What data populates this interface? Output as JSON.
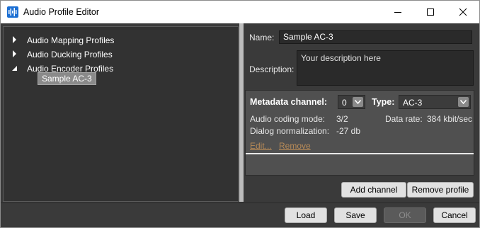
{
  "window": {
    "title": "Audio Profile Editor",
    "icon": "audio-waveform-icon"
  },
  "tree": {
    "items": [
      {
        "label": "Audio Mapping Profiles",
        "expanded": false
      },
      {
        "label": "Audio Ducking Profiles",
        "expanded": false
      },
      {
        "label": "Audio Encoder Profiles",
        "expanded": true
      }
    ],
    "child": {
      "label": "Sample AC-3",
      "selected": true
    }
  },
  "form": {
    "name_label": "Name:",
    "name_value": "Sample AC-3",
    "description_label": "Description:",
    "description_placeholder": "Your description here"
  },
  "metadata": {
    "channel_label": "Metadata channel:",
    "channel_value": "0",
    "type_label": "Type:",
    "type_value": "AC-3",
    "coding_mode_label": "Audio coding mode:",
    "coding_mode_value": "3/2",
    "data_rate_label": "Data rate:",
    "data_rate_value": "384 kbit/sec",
    "dialog_norm_label": "Dialog normalization:",
    "dialog_norm_value": "-27 db",
    "edit_link": "Edit...",
    "remove_link": "Remove"
  },
  "actions": {
    "add_channel": "Add channel",
    "remove_profile": "Remove profile"
  },
  "footer": {
    "load": "Load",
    "save": "Save",
    "ok": "OK",
    "cancel": "Cancel"
  },
  "colors": {
    "background": "#3a3a3a",
    "tree_background": "#323232",
    "link": "#b78a57",
    "app_icon": "#1b6fd3"
  }
}
